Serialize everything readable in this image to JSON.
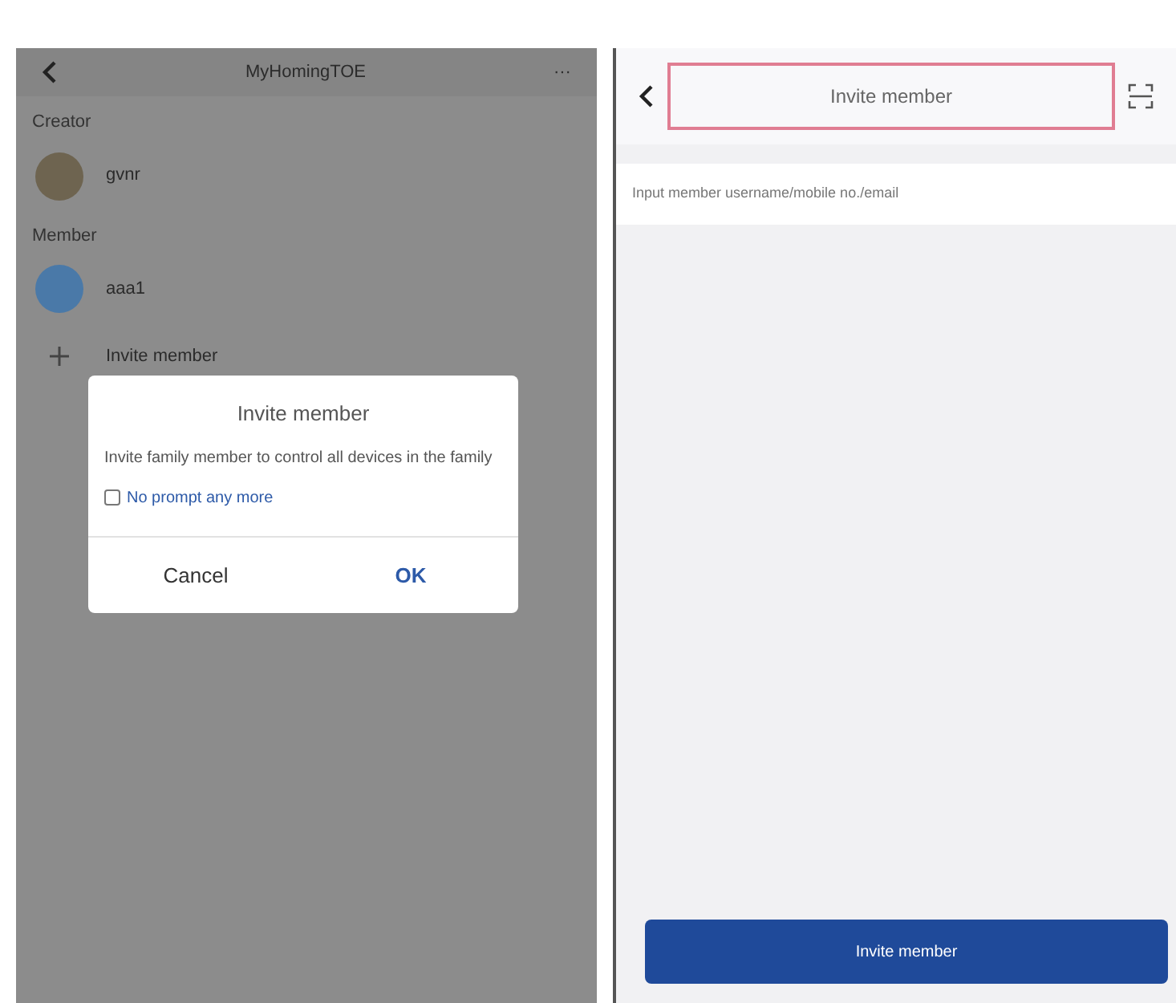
{
  "left_screen": {
    "title": "MyHomingTOE",
    "more": "···",
    "creator_label": "Creator",
    "creator": {
      "name": "gvnr"
    },
    "member_label": "Member",
    "members": [
      {
        "name": "aaa1"
      }
    ],
    "invite_row": "Invite member"
  },
  "dialog": {
    "title": "Invite member",
    "message": "Invite family member to control all devices in the family",
    "no_prompt": {
      "label": "No prompt any more",
      "checked": false
    },
    "buttons": [
      {
        "label": "Cancel",
        "kind": "cancel"
      },
      {
        "label": "OK",
        "kind": "ok"
      }
    ]
  },
  "right_screen": {
    "title": "Invite member",
    "title_highlighted": true,
    "input": {
      "placeholder": "Input member username/mobile no./email"
    },
    "button": "Invite member"
  }
}
